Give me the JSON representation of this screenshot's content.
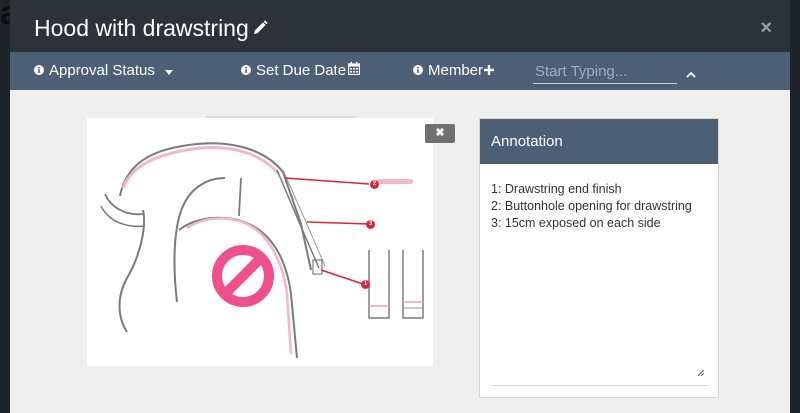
{
  "modal": {
    "title": "Hood with drawstring",
    "close_label": "×"
  },
  "toolbar": {
    "approval_label": "Approval Status",
    "due_date_label": "Set Due Date",
    "member_label": "Member",
    "search_placeholder": "Start Typing..."
  },
  "image": {
    "close_label": "✖",
    "markers": [
      "1",
      "2",
      "3"
    ]
  },
  "annotation": {
    "header": "Annotation",
    "text": "1: Drawstring end finish\n2: Buttonhole opening for drawstring\n3: 15cm exposed on each side"
  },
  "colors": {
    "title_bar": "#2c3237",
    "toolbar": "#4d5f74",
    "marker_red": "#d9263a",
    "marker_pink": "#ef4f8a"
  },
  "icons": {
    "edit": "pencil-icon",
    "close": "close-icon",
    "info": "info-circle-icon",
    "calendar": "calendar-icon",
    "add": "plus-icon",
    "collapse": "chevron-up-icon",
    "prohibited": "prohibited-icon"
  }
}
